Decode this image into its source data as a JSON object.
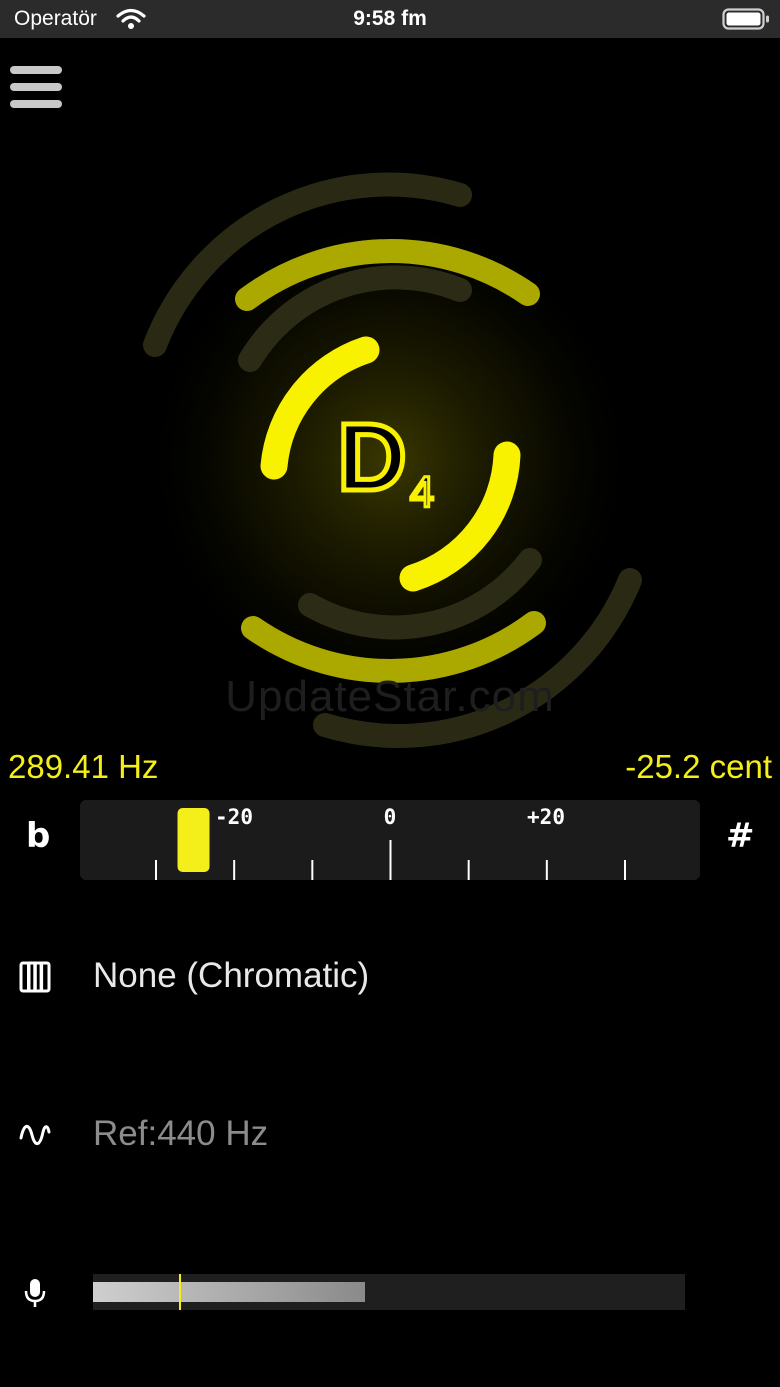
{
  "status_bar": {
    "carrier": "Operatör",
    "time": "9:58 fm"
  },
  "note": {
    "name": "D",
    "octave": "4"
  },
  "watermark": "UpdateStar.com",
  "readout": {
    "frequency": "289.41 Hz",
    "cents": "-25.2 cent",
    "cents_value": -25.2
  },
  "meter": {
    "flat_symbol": "b",
    "sharp_symbol": "#",
    "tick_labels": [
      "-20",
      "0",
      "+20"
    ],
    "range": [
      -40,
      40
    ]
  },
  "settings": {
    "temperament_label": "None (Chromatic)",
    "reference_prefix": "Ref:",
    "reference_value": "440 Hz"
  },
  "input_level": {
    "level": 0.46,
    "threshold": 0.145
  },
  "colors": {
    "accent": "#f4ee1b",
    "background": "#000000",
    "meter_bg": "#1b1b1b"
  },
  "icons": {
    "menu": "hamburger-icon",
    "temperament": "piano-keys-icon",
    "reference": "sine-wave-icon",
    "input": "microphone-icon"
  }
}
